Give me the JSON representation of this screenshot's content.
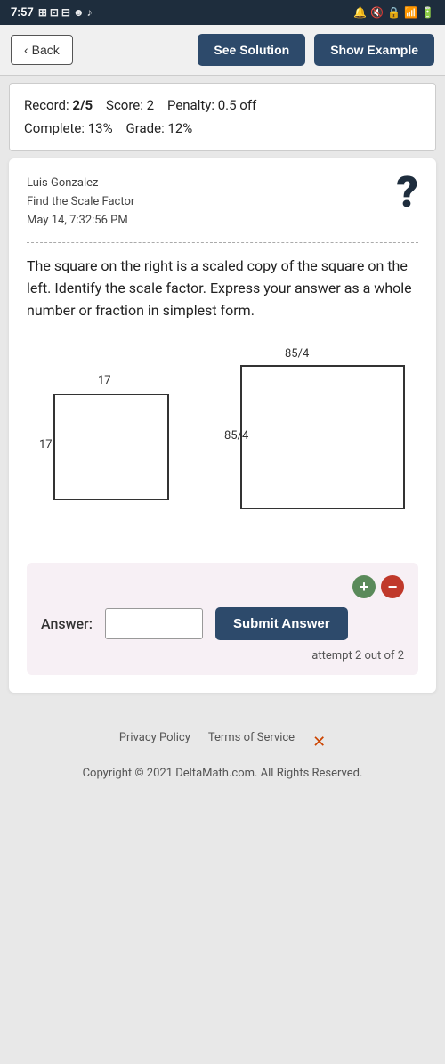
{
  "statusBar": {
    "time": "7:57",
    "icons": [
      "notifications",
      "volume-off",
      "lock",
      "signal",
      "battery"
    ]
  },
  "nav": {
    "backLabel": "Back",
    "seeSolutionLabel": "See Solution",
    "showExampleLabel": "Show Example"
  },
  "scoreBar": {
    "recordLabel": "Record:",
    "recordValue": "2/5",
    "scoreLabel": "Score:",
    "scoreValue": "2",
    "penaltyLabel": "Penalty:",
    "penaltyValue": "0.5 off",
    "completeLabel": "Complete:",
    "completeValue": "13%",
    "gradeLabel": "Grade:",
    "gradeValue": "12%"
  },
  "card": {
    "studentName": "Luis Gonzalez",
    "topic": "Find the Scale Factor",
    "date": "May 14, 7:32:56 PM",
    "problemText": "The square on the right is a scaled copy of the square on the left. Identify the scale factor. Express your answer as a whole number or fraction in simplest form.",
    "diagram": {
      "leftSquare": {
        "topLabel": "17",
        "sideLabel": "17"
      },
      "rightSquare": {
        "topLabel": "85/4",
        "sideLabel": "85/4"
      }
    },
    "answer": {
      "label": "Answer:",
      "placeholder": "",
      "submitLabel": "Submit Answer",
      "attemptText": "attempt 2 out of 2"
    }
  },
  "footer": {
    "privacyPolicy": "Privacy Policy",
    "termsOfService": "Terms of Service",
    "copyright": "Copyright © 2021 DeltaMath.com. All Rights Reserved."
  }
}
